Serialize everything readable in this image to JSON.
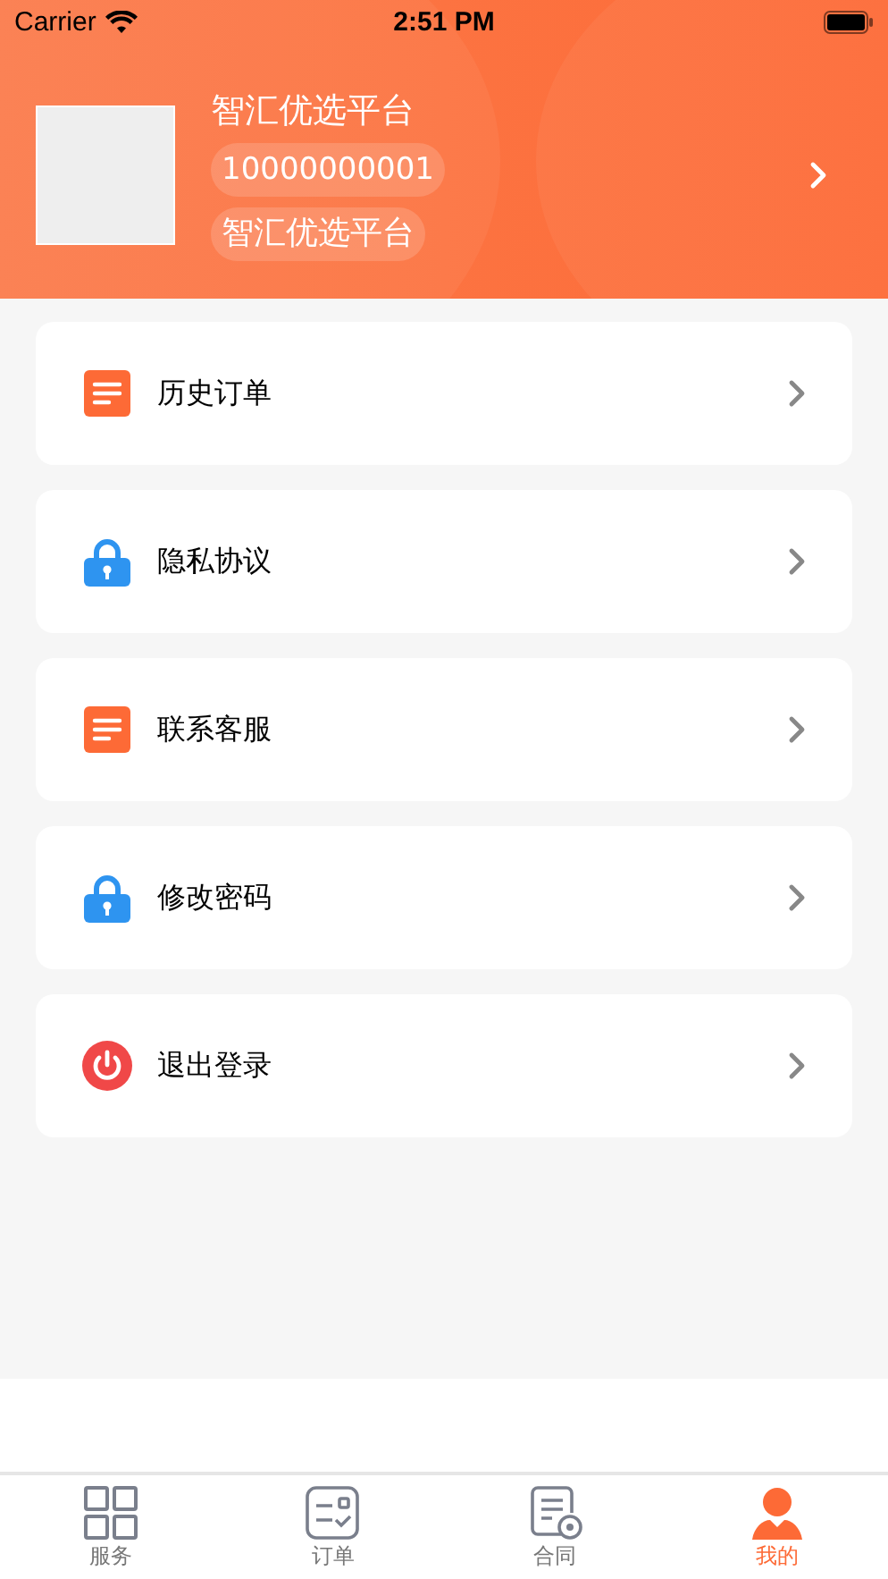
{
  "status_bar": {
    "carrier": "Carrier",
    "time": "2:51 PM"
  },
  "profile": {
    "name": "智汇优选平台",
    "phone": "10000000001",
    "company": "智汇优选平台"
  },
  "menu": [
    {
      "kind": "document",
      "label": "历史订单"
    },
    {
      "kind": "lock",
      "label": "隐私协议"
    },
    {
      "kind": "document",
      "label": "联系客服"
    },
    {
      "kind": "lock",
      "label": "修改密码"
    },
    {
      "kind": "power",
      "label": "退出登录"
    }
  ],
  "tabs": [
    {
      "kind": "grid",
      "label": "服务",
      "selected": false
    },
    {
      "kind": "order",
      "label": "订单",
      "selected": false
    },
    {
      "kind": "contract",
      "label": "合同",
      "selected": false
    },
    {
      "kind": "person",
      "label": "我的",
      "selected": true
    }
  ]
}
